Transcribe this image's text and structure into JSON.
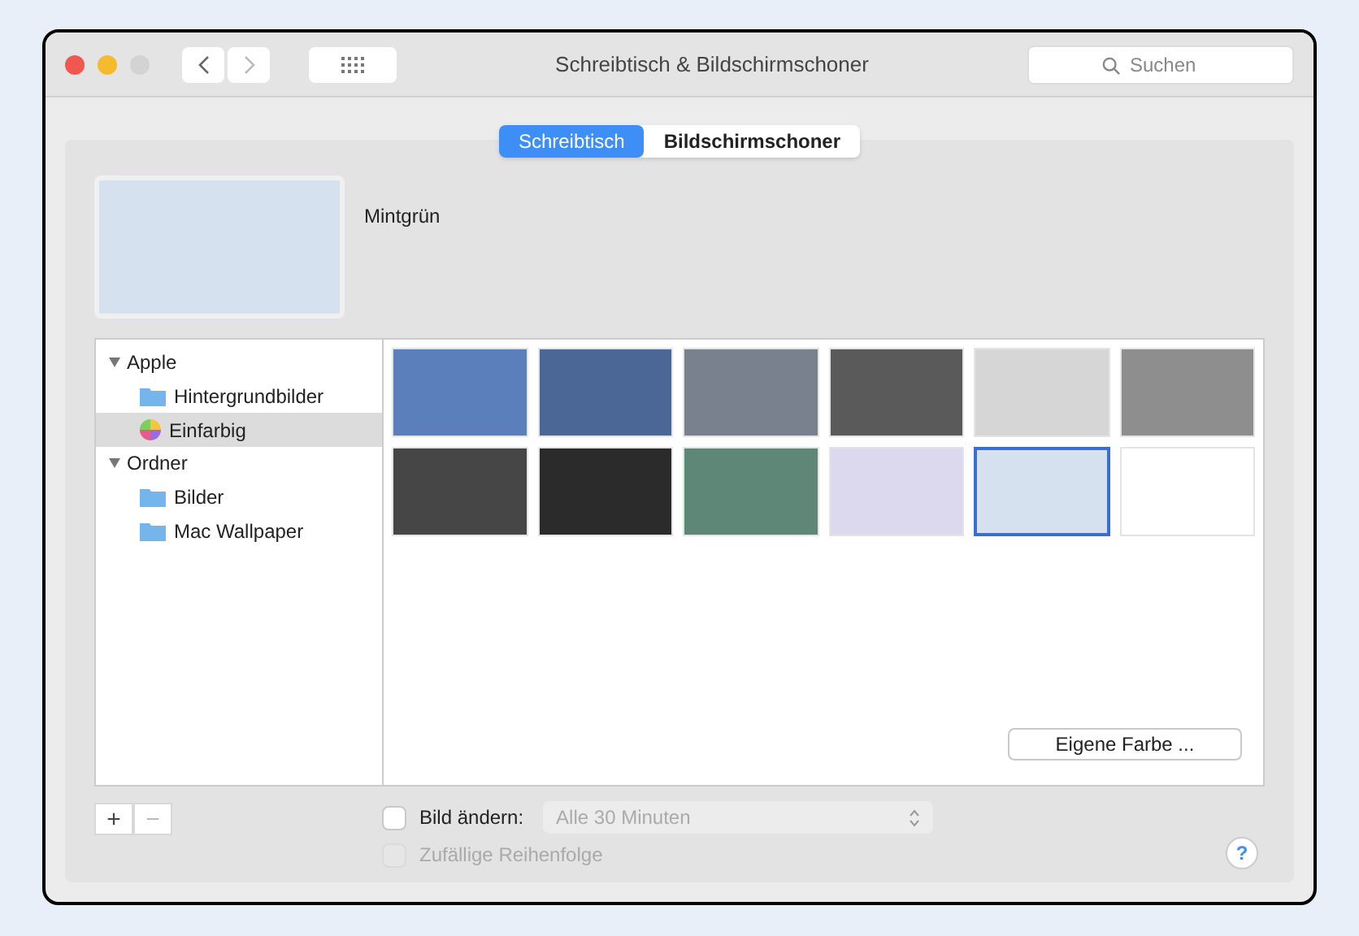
{
  "window": {
    "title": "Schreibtisch & Bildschirmschoner"
  },
  "search": {
    "placeholder": "Suchen"
  },
  "tabs": [
    {
      "label": "Schreibtisch",
      "selected": true
    },
    {
      "label": "Bildschirmschoner",
      "selected": false
    }
  ],
  "preview": {
    "name": "Mintgrün",
    "color": "#d5e1ef"
  },
  "sidebar": {
    "groups": [
      {
        "label": "Apple",
        "expanded": true,
        "children": [
          {
            "label": "Hintergrundbilder",
            "kind": "folder",
            "selected": false
          },
          {
            "label": "Einfarbig",
            "kind": "colors",
            "selected": true
          }
        ]
      },
      {
        "label": "Ordner",
        "expanded": true,
        "children": [
          {
            "label": "Bilder",
            "kind": "folder",
            "selected": false
          },
          {
            "label": "Mac Wallpaper",
            "kind": "folder",
            "selected": false
          }
        ]
      }
    ]
  },
  "swatches": [
    {
      "color": "#5a7fba",
      "selected": false
    },
    {
      "color": "#4a6795",
      "selected": false
    },
    {
      "color": "#79808e",
      "selected": false
    },
    {
      "color": "#5a5a5a",
      "selected": false
    },
    {
      "color": "#d6d6d6",
      "selected": false
    },
    {
      "color": "#8e8e8e",
      "selected": false
    },
    {
      "color": "#464646",
      "selected": false
    },
    {
      "color": "#2b2b2b",
      "selected": false
    },
    {
      "color": "#5e8777",
      "selected": false
    },
    {
      "color": "#dcd9ee",
      "selected": false
    },
    {
      "color": "#d5e1ef",
      "selected": true
    },
    {
      "color": "#ffffff",
      "selected": false
    }
  ],
  "custom_color_button": "Eigene Farbe ...",
  "add_button": "+",
  "remove_button": "−",
  "change_picture": {
    "label": "Bild ändern:",
    "checked": false,
    "interval": "Alle 30 Minuten"
  },
  "random_order": {
    "label": "Zufällige Reihenfolge",
    "checked": false,
    "disabled": true
  },
  "help_button": "?"
}
